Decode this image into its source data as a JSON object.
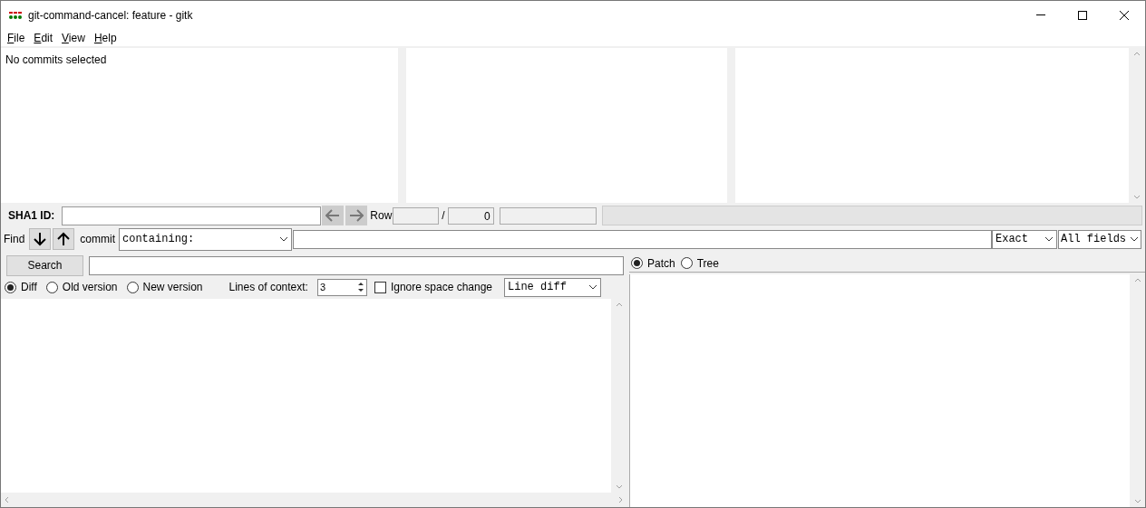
{
  "window": {
    "title": "git-command-cancel: feature - gitk"
  },
  "menu": [
    {
      "label": "File"
    },
    {
      "label": "Edit"
    },
    {
      "label": "View"
    },
    {
      "label": "Help"
    }
  ],
  "commit_panes": {
    "message": "No commits selected"
  },
  "sha_row": {
    "label": "SHA1 ID:",
    "row_label": "Row",
    "row_separator": "/",
    "row_total": "0",
    "progress": {
      "level": 0
    }
  },
  "find_row": {
    "label": "Find",
    "type_label": "commit",
    "mode": "containing:",
    "match": "Exact",
    "fields": "All fields"
  },
  "search": {
    "button": "Search"
  },
  "diff_options": {
    "views": [
      {
        "label": "Diff",
        "selected": true
      },
      {
        "label": "Old version",
        "selected": false
      },
      {
        "label": "New version",
        "selected": false
      }
    ],
    "context_label": "Lines of context:",
    "context_value": "3",
    "ignore_space": {
      "label": "Ignore space change",
      "checked": false
    },
    "diff_mode": "Line diff"
  },
  "file_view": [
    {
      "label": "Patch",
      "selected": true
    },
    {
      "label": "Tree",
      "selected": false
    }
  ]
}
